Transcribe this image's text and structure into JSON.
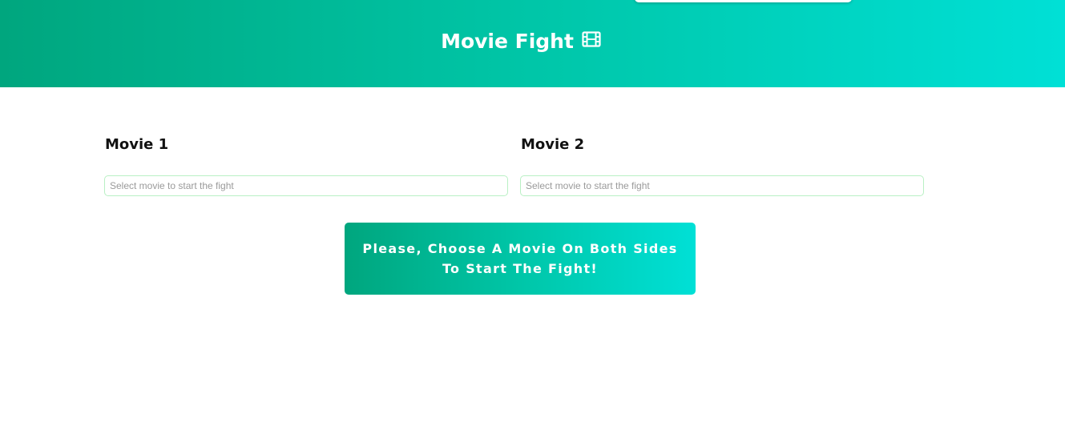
{
  "header": {
    "title": "Movie Fight",
    "icon": "film-icon",
    "gradient_start": "#00a67e",
    "gradient_end": "#00e0d6"
  },
  "columns": [
    {
      "label": "Movie 1",
      "input_placeholder": "Select movie to start the fight",
      "input_value": ""
    },
    {
      "label": "Movie 2",
      "input_placeholder": "Select movie to start the fight",
      "input_value": ""
    }
  ],
  "action": {
    "line1": "Please, Choose A Movie On Both Sides",
    "line2": "To Start The Fight!"
  },
  "colors": {
    "accent": "#00c6a8",
    "input_border": "#b9f0c4",
    "text": "#111111",
    "background": "#ffffff"
  }
}
